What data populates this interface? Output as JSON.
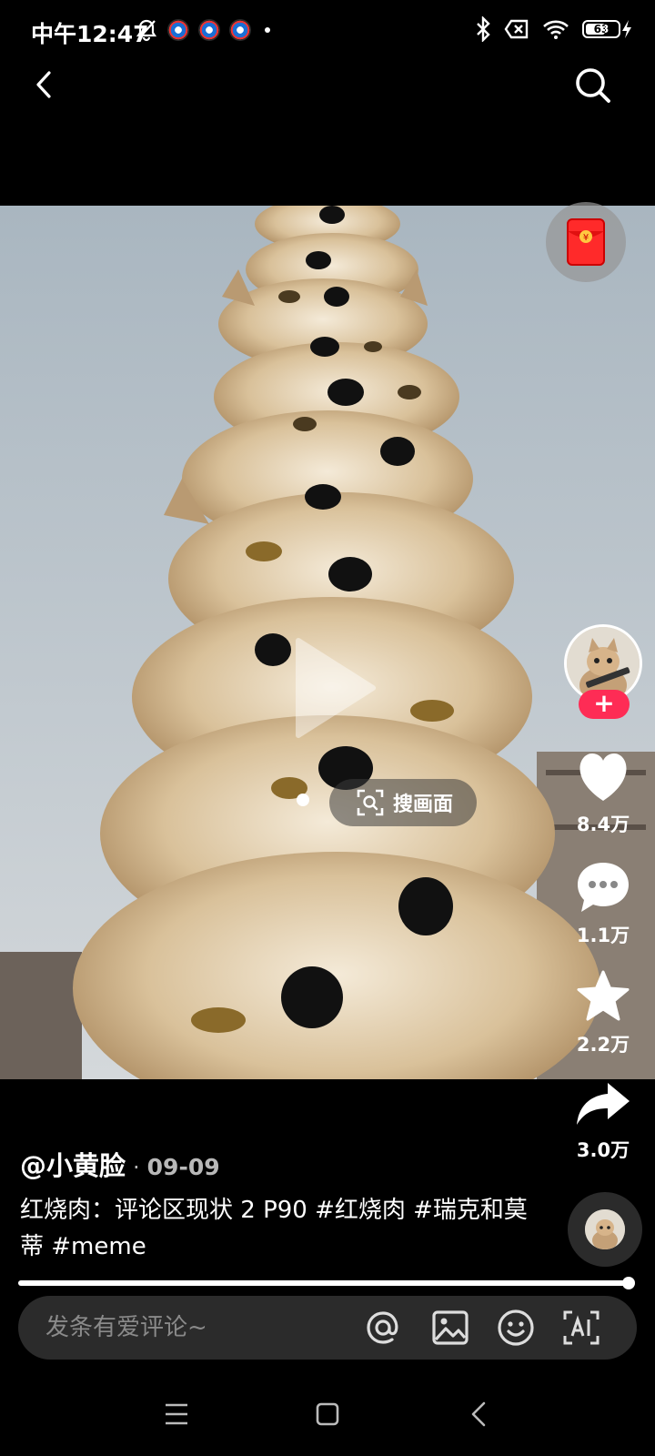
{
  "status_bar": {
    "time": "中午12:47",
    "battery_level": 63,
    "battery_label": "63"
  },
  "actions": {
    "likes": "8.4万",
    "comments": "1.1万",
    "favorites": "2.2万",
    "shares": "3.0万",
    "follow_label": "+"
  },
  "video": {
    "search_frame_label": "搜画面"
  },
  "post": {
    "author": "@小黄脸",
    "separator": "·",
    "date": "09-09",
    "caption": "红烧肉：评论区现状 2 P90 #红烧肉 #瑞克和莫蒂 #meme",
    "progress": 1.0
  },
  "comment_bar": {
    "placeholder": "发条有爱评论~"
  },
  "icons": {
    "back": "chevron-left-icon",
    "search": "search-icon",
    "like": "heart-icon",
    "comment": "comment-icon",
    "favorite": "star-icon",
    "share": "share-icon",
    "mention": "at-icon",
    "image": "image-icon",
    "emoji": "emoji-icon",
    "ai": "ai-icon"
  },
  "colors": {
    "accent": "#fe2c55",
    "background": "#000000",
    "comment_bar": "#2b2b2b"
  }
}
